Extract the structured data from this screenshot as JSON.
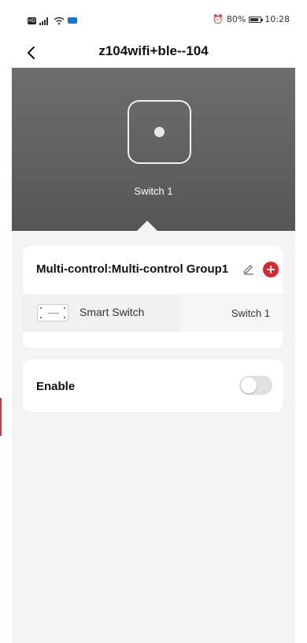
{
  "status_bar": {
    "hd": "HD",
    "network": "4G",
    "alarm": "⏰",
    "battery_level": "80%",
    "battery_fraction": 0.8,
    "time": "10:28"
  },
  "nav": {
    "title": "z104wifi+ble--104",
    "back_icon": "chevron-left-icon"
  },
  "device_panel": {
    "switch_label": "Switch 1"
  },
  "group": {
    "title": "Multi-control:Multi-control Group1",
    "edit_icon": "pencil-icon",
    "add_icon": "plus-circle-icon",
    "add_color": "#e5242a",
    "devices": [
      {
        "name": "Smart Switch",
        "switch": "Switch 1"
      }
    ]
  },
  "enable": {
    "label": "Enable",
    "on": false
  }
}
